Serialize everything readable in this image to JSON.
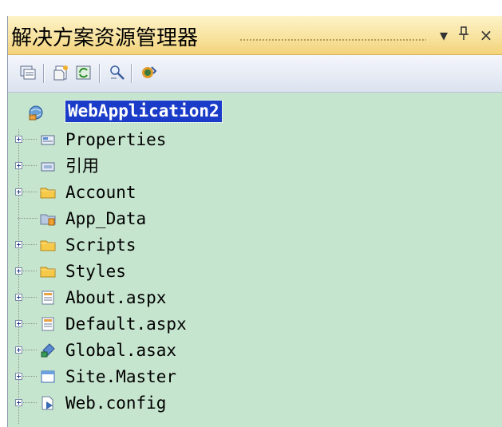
{
  "panel": {
    "title": "解决方案资源管理器",
    "dropdown_glyph": "▾",
    "pin_glyph": "ᚬ",
    "close_glyph": "×"
  },
  "toolbar": {
    "buttons": [
      "properties-icon",
      "show-all-files-icon",
      "refresh-icon",
      "view-code-icon",
      "copy-website-icon"
    ]
  },
  "tree": {
    "root": {
      "label": "WebApplication2",
      "icon": "web-project-icon"
    },
    "items": [
      {
        "label": "Properties",
        "icon": "properties-folder-icon",
        "expandable": true
      },
      {
        "label": "引用",
        "icon": "references-icon",
        "expandable": true
      },
      {
        "label": "Account",
        "icon": "folder-icon",
        "expandable": true
      },
      {
        "label": "App_Data",
        "icon": "app-data-folder-icon",
        "expandable": false
      },
      {
        "label": "Scripts",
        "icon": "folder-icon",
        "expandable": true
      },
      {
        "label": "Styles",
        "icon": "folder-icon",
        "expandable": true
      },
      {
        "label": "About.aspx",
        "icon": "aspx-file-icon",
        "expandable": true
      },
      {
        "label": "Default.aspx",
        "icon": "aspx-file-icon",
        "expandable": true
      },
      {
        "label": "Global.asax",
        "icon": "global-asax-icon",
        "expandable": true
      },
      {
        "label": "Site.Master",
        "icon": "master-page-icon",
        "expandable": true
      },
      {
        "label": "Web.config",
        "icon": "config-file-icon",
        "expandable": true
      }
    ]
  },
  "colors": {
    "tree_background": "#c6e5cf",
    "selection": "#1a3cc8",
    "title_gradient_top": "#fdf3c8",
    "title_gradient_bottom": "#f3d27a"
  }
}
